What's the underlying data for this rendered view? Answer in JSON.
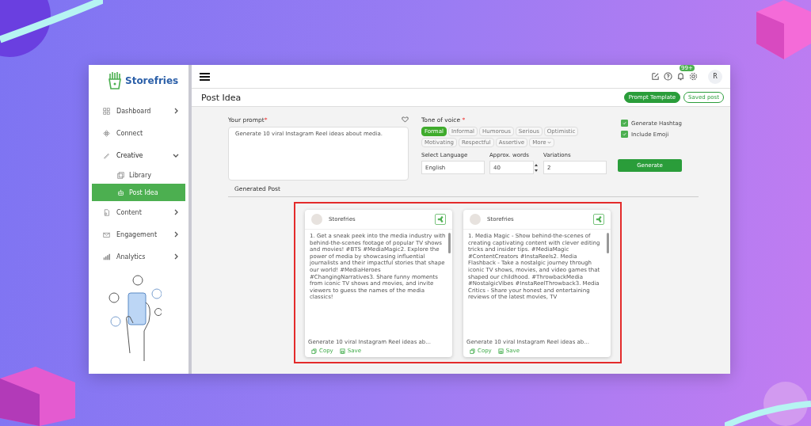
{
  "sidebar": {
    "logo": "Storefries",
    "items": [
      {
        "label": "Dashboard",
        "kind": "menu",
        "expanded": false
      },
      {
        "label": "Connect",
        "kind": "link"
      },
      {
        "label": "Creative",
        "kind": "menu",
        "expanded": true,
        "children": [
          {
            "label": "Library",
            "selected": false
          },
          {
            "label": "Post Idea",
            "selected": true
          }
        ]
      },
      {
        "label": "Content",
        "kind": "menu",
        "expanded": false
      },
      {
        "label": "Engagement",
        "kind": "menu",
        "expanded": false
      },
      {
        "label": "Analytics",
        "kind": "menu",
        "expanded": false
      }
    ]
  },
  "topbar": {
    "notification_count": "99+",
    "avatar": "R"
  },
  "header": {
    "title": "Post Idea",
    "buttons": [
      {
        "label": "Prompt Template",
        "kind": "primary"
      },
      {
        "label": "Saved post",
        "kind": "outline"
      }
    ]
  },
  "prompt": {
    "label": "Your prompt",
    "required_mark": "*",
    "value": "Generate 10 viral Instagram Reel ideas about media."
  },
  "tone": {
    "label": "Tone of voice",
    "required_mark": "*",
    "options": [
      {
        "label": "Formal",
        "selected": true
      },
      {
        "label": "Informal",
        "selected": false
      },
      {
        "label": "Humorous",
        "selected": false
      },
      {
        "label": "Serious",
        "selected": false
      },
      {
        "label": "Optimistic",
        "selected": false
      },
      {
        "label": "Motivating",
        "selected": false
      },
      {
        "label": "Respectful",
        "selected": false
      },
      {
        "label": "Assertive",
        "selected": false
      }
    ],
    "more": "More"
  },
  "options": [
    {
      "label": "Generate Hashtag",
      "checked": true
    },
    {
      "label": "Include Emoji",
      "checked": true
    }
  ],
  "language": {
    "label": "Select Language",
    "value": "English"
  },
  "words": {
    "label": "Approx. words",
    "value": "40"
  },
  "variations": {
    "label": "Variations",
    "value": "2"
  },
  "generate_button": "Generate",
  "section_title": "Generated Post",
  "posts": [
    {
      "author": "Storefries",
      "text": "1. Get a sneak peek into the media industry with behind-the-scenes footage of popular TV shows and movies! #BTS #MediaMagic2. Explore the power of media by showcasing influential journalists and their impactful stories that shape our world! #MediaHeroes #ChangingNarratives3. Share funny moments from iconic TV shows and movies, and invite viewers to guess the names of the media classics!",
      "caption": "Generate 10 viral Instagram Reel ideas ab...",
      "actions": [
        "Copy",
        "Save"
      ]
    },
    {
      "author": "Storefries",
      "text": "1. Media Magic - Show behind-the-scenes of creating captivating content with clever editing tricks and insider tips. #MediaMagic #ContentCreators #InstaReels2. Media Flashback - Take a nostalgic journey through iconic TV shows, movies, and video games that shaped our childhood. #ThrowbackMedia #NostalgicVibes #InstaReelThrowback3. Media Critics - Share your honest and entertaining reviews of the latest movies, TV",
      "caption": "Generate 10 viral Instagram Reel ideas ab...",
      "actions": [
        "Copy",
        "Save"
      ]
    }
  ]
}
